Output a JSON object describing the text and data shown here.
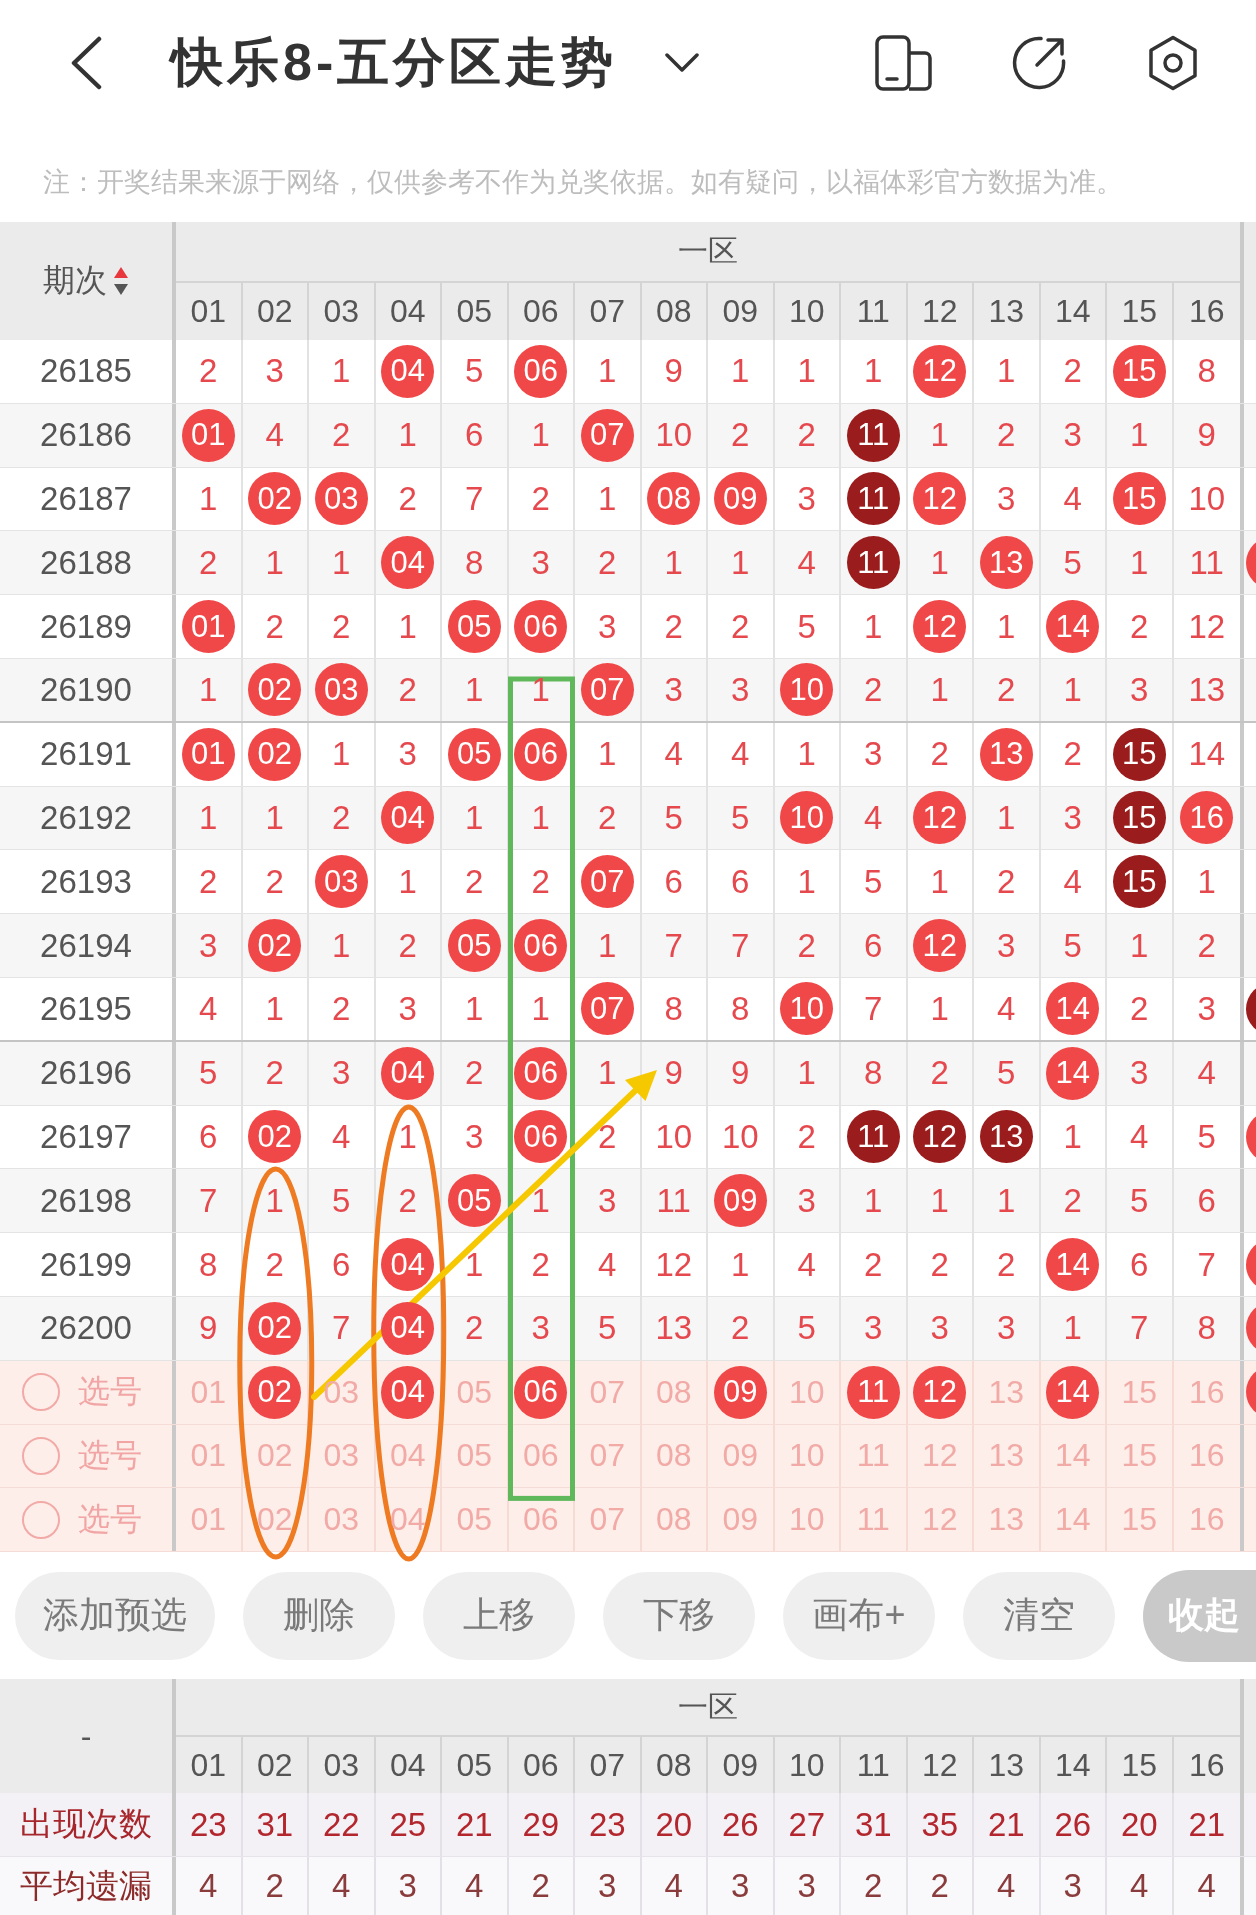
{
  "header": {
    "title": "快乐8-五分区走势"
  },
  "notice": "注：开奖结果来源于网络，仅供参考不作为兑奖依据。如有疑问，以福体彩官方数据为准。",
  "trend_table": {
    "period_header": "期次",
    "sort_up": true,
    "sort_down": false,
    "zone_label": "一区",
    "columns": [
      "01",
      "02",
      "03",
      "04",
      "05",
      "06",
      "07",
      "08",
      "09",
      "10",
      "11",
      "12",
      "13",
      "14",
      "15",
      "16"
    ],
    "rows": [
      {
        "period": "26185",
        "divider_below": false,
        "cells": [
          {
            "text": "2",
            "kind": "miss"
          },
          {
            "text": "3",
            "kind": "miss"
          },
          {
            "text": "1",
            "kind": "miss"
          },
          {
            "text": "04",
            "kind": "hit"
          },
          {
            "text": "5",
            "kind": "miss"
          },
          {
            "text": "06",
            "kind": "hit"
          },
          {
            "text": "1",
            "kind": "miss"
          },
          {
            "text": "9",
            "kind": "miss"
          },
          {
            "text": "1",
            "kind": "miss"
          },
          {
            "text": "1",
            "kind": "miss"
          },
          {
            "text": "1",
            "kind": "miss"
          },
          {
            "text": "12",
            "kind": "hit"
          },
          {
            "text": "1",
            "kind": "miss"
          },
          {
            "text": "2",
            "kind": "miss"
          },
          {
            "text": "15",
            "kind": "hit"
          },
          {
            "text": "8",
            "kind": "miss"
          }
        ]
      },
      {
        "period": "26186",
        "divider_below": false,
        "cells": [
          {
            "text": "01",
            "kind": "hit"
          },
          {
            "text": "4",
            "kind": "miss"
          },
          {
            "text": "2",
            "kind": "miss"
          },
          {
            "text": "1",
            "kind": "miss"
          },
          {
            "text": "6",
            "kind": "miss"
          },
          {
            "text": "1",
            "kind": "miss"
          },
          {
            "text": "07",
            "kind": "hit"
          },
          {
            "text": "10",
            "kind": "miss"
          },
          {
            "text": "2",
            "kind": "miss"
          },
          {
            "text": "2",
            "kind": "miss"
          },
          {
            "text": "11",
            "kind": "hit_dark"
          },
          {
            "text": "1",
            "kind": "miss"
          },
          {
            "text": "2",
            "kind": "miss"
          },
          {
            "text": "3",
            "kind": "miss"
          },
          {
            "text": "1",
            "kind": "miss"
          },
          {
            "text": "9",
            "kind": "miss"
          }
        ]
      },
      {
        "period": "26187",
        "divider_below": false,
        "cells": [
          {
            "text": "1",
            "kind": "miss"
          },
          {
            "text": "02",
            "kind": "hit"
          },
          {
            "text": "03",
            "kind": "hit"
          },
          {
            "text": "2",
            "kind": "miss"
          },
          {
            "text": "7",
            "kind": "miss"
          },
          {
            "text": "2",
            "kind": "miss"
          },
          {
            "text": "1",
            "kind": "miss"
          },
          {
            "text": "08",
            "kind": "hit"
          },
          {
            "text": "09",
            "kind": "hit"
          },
          {
            "text": "3",
            "kind": "miss"
          },
          {
            "text": "11",
            "kind": "hit_dark"
          },
          {
            "text": "12",
            "kind": "hit"
          },
          {
            "text": "3",
            "kind": "miss"
          },
          {
            "text": "4",
            "kind": "miss"
          },
          {
            "text": "15",
            "kind": "hit"
          },
          {
            "text": "10",
            "kind": "miss"
          }
        ]
      },
      {
        "period": "26188",
        "divider_below": false,
        "edge_ball": {
          "color": "#f04848"
        },
        "cells": [
          {
            "text": "2",
            "kind": "miss"
          },
          {
            "text": "1",
            "kind": "miss"
          },
          {
            "text": "1",
            "kind": "miss"
          },
          {
            "text": "04",
            "kind": "hit"
          },
          {
            "text": "8",
            "kind": "miss"
          },
          {
            "text": "3",
            "kind": "miss"
          },
          {
            "text": "2",
            "kind": "miss"
          },
          {
            "text": "1",
            "kind": "miss"
          },
          {
            "text": "1",
            "kind": "miss"
          },
          {
            "text": "4",
            "kind": "miss"
          },
          {
            "text": "11",
            "kind": "hit_dark"
          },
          {
            "text": "1",
            "kind": "miss"
          },
          {
            "text": "13",
            "kind": "hit"
          },
          {
            "text": "5",
            "kind": "miss"
          },
          {
            "text": "1",
            "kind": "miss"
          },
          {
            "text": "11",
            "kind": "miss"
          }
        ]
      },
      {
        "period": "26189",
        "divider_below": false,
        "cells": [
          {
            "text": "01",
            "kind": "hit"
          },
          {
            "text": "2",
            "kind": "miss"
          },
          {
            "text": "2",
            "kind": "miss"
          },
          {
            "text": "1",
            "kind": "miss"
          },
          {
            "text": "05",
            "kind": "hit"
          },
          {
            "text": "06",
            "kind": "hit"
          },
          {
            "text": "3",
            "kind": "miss"
          },
          {
            "text": "2",
            "kind": "miss"
          },
          {
            "text": "2",
            "kind": "miss"
          },
          {
            "text": "5",
            "kind": "miss"
          },
          {
            "text": "1",
            "kind": "miss"
          },
          {
            "text": "12",
            "kind": "hit"
          },
          {
            "text": "1",
            "kind": "miss"
          },
          {
            "text": "14",
            "kind": "hit"
          },
          {
            "text": "2",
            "kind": "miss"
          },
          {
            "text": "12",
            "kind": "miss"
          }
        ]
      },
      {
        "period": "26190",
        "divider_below": true,
        "cells": [
          {
            "text": "1",
            "kind": "miss"
          },
          {
            "text": "02",
            "kind": "hit"
          },
          {
            "text": "03",
            "kind": "hit"
          },
          {
            "text": "2",
            "kind": "miss"
          },
          {
            "text": "1",
            "kind": "miss"
          },
          {
            "text": "1",
            "kind": "miss"
          },
          {
            "text": "07",
            "kind": "hit"
          },
          {
            "text": "3",
            "kind": "miss"
          },
          {
            "text": "3",
            "kind": "miss"
          },
          {
            "text": "10",
            "kind": "hit"
          },
          {
            "text": "2",
            "kind": "miss"
          },
          {
            "text": "1",
            "kind": "miss"
          },
          {
            "text": "2",
            "kind": "miss"
          },
          {
            "text": "1",
            "kind": "miss"
          },
          {
            "text": "3",
            "kind": "miss"
          },
          {
            "text": "13",
            "kind": "miss"
          }
        ]
      },
      {
        "period": "26191",
        "divider_below": false,
        "cells": [
          {
            "text": "01",
            "kind": "hit"
          },
          {
            "text": "02",
            "kind": "hit"
          },
          {
            "text": "1",
            "kind": "miss"
          },
          {
            "text": "3",
            "kind": "miss"
          },
          {
            "text": "05",
            "kind": "hit"
          },
          {
            "text": "06",
            "kind": "hit"
          },
          {
            "text": "1",
            "kind": "miss"
          },
          {
            "text": "4",
            "kind": "miss"
          },
          {
            "text": "4",
            "kind": "miss"
          },
          {
            "text": "1",
            "kind": "miss"
          },
          {
            "text": "3",
            "kind": "miss"
          },
          {
            "text": "2",
            "kind": "miss"
          },
          {
            "text": "13",
            "kind": "hit"
          },
          {
            "text": "2",
            "kind": "miss"
          },
          {
            "text": "15",
            "kind": "hit_dark"
          },
          {
            "text": "14",
            "kind": "miss"
          }
        ]
      },
      {
        "period": "26192",
        "divider_below": false,
        "cells": [
          {
            "text": "1",
            "kind": "miss"
          },
          {
            "text": "1",
            "kind": "miss"
          },
          {
            "text": "2",
            "kind": "miss"
          },
          {
            "text": "04",
            "kind": "hit"
          },
          {
            "text": "1",
            "kind": "miss"
          },
          {
            "text": "1",
            "kind": "miss"
          },
          {
            "text": "2",
            "kind": "miss"
          },
          {
            "text": "5",
            "kind": "miss"
          },
          {
            "text": "5",
            "kind": "miss"
          },
          {
            "text": "10",
            "kind": "hit"
          },
          {
            "text": "4",
            "kind": "miss"
          },
          {
            "text": "12",
            "kind": "hit"
          },
          {
            "text": "1",
            "kind": "miss"
          },
          {
            "text": "3",
            "kind": "miss"
          },
          {
            "text": "15",
            "kind": "hit_dark"
          },
          {
            "text": "16",
            "kind": "hit"
          }
        ]
      },
      {
        "period": "26193",
        "divider_below": false,
        "cells": [
          {
            "text": "2",
            "kind": "miss"
          },
          {
            "text": "2",
            "kind": "miss"
          },
          {
            "text": "03",
            "kind": "hit"
          },
          {
            "text": "1",
            "kind": "miss"
          },
          {
            "text": "2",
            "kind": "miss"
          },
          {
            "text": "2",
            "kind": "miss"
          },
          {
            "text": "07",
            "kind": "hit"
          },
          {
            "text": "6",
            "kind": "miss"
          },
          {
            "text": "6",
            "kind": "miss"
          },
          {
            "text": "1",
            "kind": "miss"
          },
          {
            "text": "5",
            "kind": "miss"
          },
          {
            "text": "1",
            "kind": "miss"
          },
          {
            "text": "2",
            "kind": "miss"
          },
          {
            "text": "4",
            "kind": "miss"
          },
          {
            "text": "15",
            "kind": "hit_dark"
          },
          {
            "text": "1",
            "kind": "miss"
          }
        ]
      },
      {
        "period": "26194",
        "divider_below": false,
        "cells": [
          {
            "text": "3",
            "kind": "miss"
          },
          {
            "text": "02",
            "kind": "hit"
          },
          {
            "text": "1",
            "kind": "miss"
          },
          {
            "text": "2",
            "kind": "miss"
          },
          {
            "text": "05",
            "kind": "hit"
          },
          {
            "text": "06",
            "kind": "hit"
          },
          {
            "text": "1",
            "kind": "miss"
          },
          {
            "text": "7",
            "kind": "miss"
          },
          {
            "text": "7",
            "kind": "miss"
          },
          {
            "text": "2",
            "kind": "miss"
          },
          {
            "text": "6",
            "kind": "miss"
          },
          {
            "text": "12",
            "kind": "hit"
          },
          {
            "text": "3",
            "kind": "miss"
          },
          {
            "text": "5",
            "kind": "miss"
          },
          {
            "text": "1",
            "kind": "miss"
          },
          {
            "text": "2",
            "kind": "miss"
          }
        ]
      },
      {
        "period": "26195",
        "divider_below": true,
        "edge_ball": {
          "color": "#9b1c1c"
        },
        "cells": [
          {
            "text": "4",
            "kind": "miss"
          },
          {
            "text": "1",
            "kind": "miss"
          },
          {
            "text": "2",
            "kind": "miss"
          },
          {
            "text": "3",
            "kind": "miss"
          },
          {
            "text": "1",
            "kind": "miss"
          },
          {
            "text": "1",
            "kind": "miss"
          },
          {
            "text": "07",
            "kind": "hit"
          },
          {
            "text": "8",
            "kind": "miss"
          },
          {
            "text": "8",
            "kind": "miss"
          },
          {
            "text": "10",
            "kind": "hit"
          },
          {
            "text": "7",
            "kind": "miss"
          },
          {
            "text": "1",
            "kind": "miss"
          },
          {
            "text": "4",
            "kind": "miss"
          },
          {
            "text": "14",
            "kind": "hit"
          },
          {
            "text": "2",
            "kind": "miss"
          },
          {
            "text": "3",
            "kind": "miss"
          }
        ]
      },
      {
        "period": "26196",
        "divider_below": false,
        "cells": [
          {
            "text": "5",
            "kind": "miss"
          },
          {
            "text": "2",
            "kind": "miss"
          },
          {
            "text": "3",
            "kind": "miss"
          },
          {
            "text": "04",
            "kind": "hit"
          },
          {
            "text": "2",
            "kind": "miss"
          },
          {
            "text": "06",
            "kind": "hit"
          },
          {
            "text": "1",
            "kind": "miss"
          },
          {
            "text": "9",
            "kind": "miss"
          },
          {
            "text": "9",
            "kind": "miss"
          },
          {
            "text": "1",
            "kind": "miss"
          },
          {
            "text": "8",
            "kind": "miss"
          },
          {
            "text": "2",
            "kind": "miss"
          },
          {
            "text": "5",
            "kind": "miss"
          },
          {
            "text": "14",
            "kind": "hit"
          },
          {
            "text": "3",
            "kind": "miss"
          },
          {
            "text": "4",
            "kind": "miss"
          }
        ]
      },
      {
        "period": "26197",
        "divider_below": false,
        "edge_ball": {
          "color": "#f04848"
        },
        "cells": [
          {
            "text": "6",
            "kind": "miss"
          },
          {
            "text": "02",
            "kind": "hit"
          },
          {
            "text": "4",
            "kind": "miss"
          },
          {
            "text": "1",
            "kind": "miss"
          },
          {
            "text": "3",
            "kind": "miss"
          },
          {
            "text": "06",
            "kind": "hit"
          },
          {
            "text": "2",
            "kind": "miss"
          },
          {
            "text": "10",
            "kind": "miss"
          },
          {
            "text": "10",
            "kind": "miss"
          },
          {
            "text": "2",
            "kind": "miss"
          },
          {
            "text": "11",
            "kind": "hit_dark"
          },
          {
            "text": "12",
            "kind": "hit_dark"
          },
          {
            "text": "13",
            "kind": "hit_dark"
          },
          {
            "text": "1",
            "kind": "miss"
          },
          {
            "text": "4",
            "kind": "miss"
          },
          {
            "text": "5",
            "kind": "miss"
          }
        ]
      },
      {
        "period": "26198",
        "divider_below": false,
        "cells": [
          {
            "text": "7",
            "kind": "miss"
          },
          {
            "text": "1",
            "kind": "miss"
          },
          {
            "text": "5",
            "kind": "miss"
          },
          {
            "text": "2",
            "kind": "miss"
          },
          {
            "text": "05",
            "kind": "hit"
          },
          {
            "text": "1",
            "kind": "miss"
          },
          {
            "text": "3",
            "kind": "miss"
          },
          {
            "text": "11",
            "kind": "miss"
          },
          {
            "text": "09",
            "kind": "hit"
          },
          {
            "text": "3",
            "kind": "miss"
          },
          {
            "text": "1",
            "kind": "miss"
          },
          {
            "text": "1",
            "kind": "miss"
          },
          {
            "text": "1",
            "kind": "miss"
          },
          {
            "text": "2",
            "kind": "miss"
          },
          {
            "text": "5",
            "kind": "miss"
          },
          {
            "text": "6",
            "kind": "miss"
          }
        ]
      },
      {
        "period": "26199",
        "divider_below": false,
        "edge_ball": {
          "color": "#f04848"
        },
        "cells": [
          {
            "text": "8",
            "kind": "miss"
          },
          {
            "text": "2",
            "kind": "miss"
          },
          {
            "text": "6",
            "kind": "miss"
          },
          {
            "text": "04",
            "kind": "hit"
          },
          {
            "text": "1",
            "kind": "miss"
          },
          {
            "text": "2",
            "kind": "miss"
          },
          {
            "text": "4",
            "kind": "miss"
          },
          {
            "text": "12",
            "kind": "miss"
          },
          {
            "text": "1",
            "kind": "miss"
          },
          {
            "text": "4",
            "kind": "miss"
          },
          {
            "text": "2",
            "kind": "miss"
          },
          {
            "text": "2",
            "kind": "miss"
          },
          {
            "text": "2",
            "kind": "miss"
          },
          {
            "text": "14",
            "kind": "hit"
          },
          {
            "text": "6",
            "kind": "miss"
          },
          {
            "text": "7",
            "kind": "miss"
          }
        ]
      },
      {
        "period": "26200",
        "divider_below": false,
        "edge_ball": {
          "color": "#f04848"
        },
        "cells": [
          {
            "text": "9",
            "kind": "miss"
          },
          {
            "text": "02",
            "kind": "hit"
          },
          {
            "text": "7",
            "kind": "miss"
          },
          {
            "text": "04",
            "kind": "hit"
          },
          {
            "text": "2",
            "kind": "miss"
          },
          {
            "text": "3",
            "kind": "miss"
          },
          {
            "text": "5",
            "kind": "miss"
          },
          {
            "text": "13",
            "kind": "miss"
          },
          {
            "text": "2",
            "kind": "miss"
          },
          {
            "text": "5",
            "kind": "miss"
          },
          {
            "text": "3",
            "kind": "miss"
          },
          {
            "text": "3",
            "kind": "miss"
          },
          {
            "text": "3",
            "kind": "miss"
          },
          {
            "text": "1",
            "kind": "miss"
          },
          {
            "text": "7",
            "kind": "miss"
          },
          {
            "text": "8",
            "kind": "miss"
          }
        ]
      }
    ],
    "pick_rows": [
      {
        "checked": false,
        "label": "选号",
        "edge_ball": {
          "color": "#f04848"
        },
        "options": [
          {
            "text": "01",
            "selected": false
          },
          {
            "text": "02",
            "selected": true
          },
          {
            "text": "03",
            "selected": false
          },
          {
            "text": "04",
            "selected": true
          },
          {
            "text": "05",
            "selected": false
          },
          {
            "text": "06",
            "selected": true
          },
          {
            "text": "07",
            "selected": false
          },
          {
            "text": "08",
            "selected": false
          },
          {
            "text": "09",
            "selected": true
          },
          {
            "text": "10",
            "selected": false
          },
          {
            "text": "11",
            "selected": true
          },
          {
            "text": "12",
            "selected": true
          },
          {
            "text": "13",
            "selected": false
          },
          {
            "text": "14",
            "selected": true
          },
          {
            "text": "15",
            "selected": false
          },
          {
            "text": "16",
            "selected": false
          }
        ]
      },
      {
        "checked": false,
        "label": "选号",
        "options": [
          {
            "text": "01",
            "selected": false
          },
          {
            "text": "02",
            "selected": false
          },
          {
            "text": "03",
            "selected": false
          },
          {
            "text": "04",
            "selected": false
          },
          {
            "text": "05",
            "selected": false
          },
          {
            "text": "06",
            "selected": false
          },
          {
            "text": "07",
            "selected": false
          },
          {
            "text": "08",
            "selected": false
          },
          {
            "text": "09",
            "selected": false
          },
          {
            "text": "10",
            "selected": false
          },
          {
            "text": "11",
            "selected": false
          },
          {
            "text": "12",
            "selected": false
          },
          {
            "text": "13",
            "selected": false
          },
          {
            "text": "14",
            "selected": false
          },
          {
            "text": "15",
            "selected": false
          },
          {
            "text": "16",
            "selected": false
          }
        ]
      },
      {
        "checked": false,
        "label": "选号",
        "options": [
          {
            "text": "01",
            "selected": false
          },
          {
            "text": "02",
            "selected": false
          },
          {
            "text": "03",
            "selected": false
          },
          {
            "text": "04",
            "selected": false
          },
          {
            "text": "05",
            "selected": false
          },
          {
            "text": "06",
            "selected": false
          },
          {
            "text": "07",
            "selected": false
          },
          {
            "text": "08",
            "selected": false
          },
          {
            "text": "09",
            "selected": false
          },
          {
            "text": "10",
            "selected": false
          },
          {
            "text": "11",
            "selected": false
          },
          {
            "text": "12",
            "selected": false
          },
          {
            "text": "13",
            "selected": false
          },
          {
            "text": "14",
            "selected": false
          },
          {
            "text": "15",
            "selected": false
          },
          {
            "text": "16",
            "selected": false
          }
        ]
      }
    ]
  },
  "actions": [
    {
      "label": "添加预选",
      "kind": "normal"
    },
    {
      "label": "删除",
      "kind": "normal"
    },
    {
      "label": "上移",
      "kind": "normal"
    },
    {
      "label": "下移",
      "kind": "normal"
    },
    {
      "label": "画布+",
      "kind": "normal"
    },
    {
      "label": "清空",
      "kind": "normal"
    },
    {
      "label": "收起",
      "kind": "primary"
    }
  ],
  "stats_table": {
    "corner": "-",
    "zone_label": "一区",
    "columns": [
      "01",
      "02",
      "03",
      "04",
      "05",
      "06",
      "07",
      "08",
      "09",
      "10",
      "11",
      "12",
      "13",
      "14",
      "15",
      "16"
    ],
    "rows": [
      {
        "label": "出现次数",
        "kind": "count",
        "values": [
          "23",
          "31",
          "22",
          "25",
          "21",
          "29",
          "23",
          "20",
          "26",
          "27",
          "31",
          "35",
          "21",
          "26",
          "20",
          "21"
        ]
      },
      {
        "label": "平均遗漏",
        "kind": "average",
        "values": [
          "4",
          "2",
          "4",
          "3",
          "4",
          "2",
          "3",
          "4",
          "3",
          "3",
          "2",
          "2",
          "4",
          "3",
          "4",
          "4"
        ]
      }
    ]
  }
}
